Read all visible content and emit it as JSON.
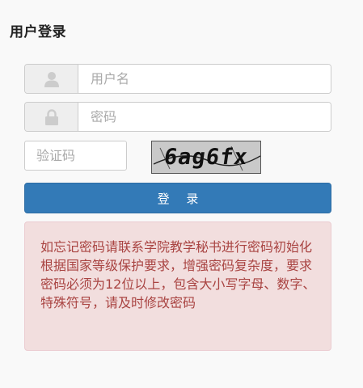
{
  "header": {
    "title": "用户登录"
  },
  "form": {
    "username": {
      "placeholder": "用户名",
      "icon": "user-icon"
    },
    "password": {
      "placeholder": "密码",
      "icon": "lock-icon"
    },
    "captcha": {
      "placeholder": "验证码",
      "image_text": "6ag6fx"
    },
    "login_label": "登 录"
  },
  "alert": {
    "line1": "如忘记密码请联系学院教学秘书进行密码初始化",
    "line2": "根据国家等级保护要求，增强密码复杂度，要求密码必须为12位以上，包含大小写字母、数字、特殊符号，请及时修改密码"
  },
  "colors": {
    "primary": "#337ab7",
    "alert_bg": "#f2dede",
    "alert_text": "#a94442",
    "addon_bg": "#eeeeee"
  }
}
